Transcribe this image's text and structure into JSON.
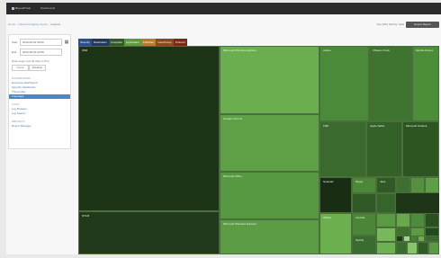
{
  "app": {
    "name": "BeyondTrust",
    "nav_link": "Dashboards",
    "header_right": ""
  },
  "breadcrumb": {
    "items": [
      "Home",
      "Threat & Integrity Layout",
      "Analysis"
    ]
  },
  "header": {
    "meta": "Top 100 | Sort by: Size",
    "button_label": "Export Report"
  },
  "sidebar": {
    "start_label": "Start",
    "start_value": "2013-06-01 00:00",
    "end_label": "End",
    "end_value": "2013-06-30 23:59",
    "range_note": "Date range: last 30 days (UTC)",
    "segments": [
      "Count",
      "Duration"
    ],
    "sections": [
      {
        "heading": "Dashboards",
        "items": [
          "Executive Dashboard",
          "Security Dashboard",
          "Threat Map",
          "Treemaps"
        ]
      },
      {
        "heading": "Logs",
        "items": [
          "Log Browser",
          "Log Search"
        ]
      },
      {
        "heading": "Reports",
        "items": [
          "Report Manager"
        ]
      }
    ]
  },
  "tabs": [
    {
      "label": "Severity",
      "color": "#2c4f8a"
    },
    {
      "label": "Destination",
      "color": "#23375f"
    },
    {
      "label": "Computer",
      "color": "#355c24"
    },
    {
      "label": "Application",
      "color": "#5f9a40"
    },
    {
      "label": "Publisher",
      "color": "#b87b2e"
    },
    {
      "label": "User/Group",
      "color": "#8a4a1d"
    },
    {
      "label": "Protocol",
      "color": "#7a2c12"
    }
  ],
  "treemap": {
    "colors": {
      "border": "#4a6e3c",
      "background": "#1e3518"
    },
    "tiles": [
      {
        "label": "WMI",
        "color": "#1d3417"
      },
      {
        "label": "NTLM",
        "color": "#223a1b"
      },
      {
        "label": "Microsoft Windows Explorer",
        "color": "#6aae4f"
      },
      {
        "label": "Google Chrome",
        "color": "#5fa047"
      },
      {
        "label": "Microsoft Office",
        "color": "#579842"
      },
      {
        "label": "Microsoft Windows Explorer",
        "color": "#5b9c44"
      },
      {
        "label": "Adobe",
        "color": "#4b8a38"
      },
      {
        "label": "VMware Tools",
        "color": "#3e7330"
      },
      {
        "label": "Mozilla Firefox",
        "color": "#4b8d39"
      },
      {
        "label": "LWP",
        "color": "#3a6a2d"
      },
      {
        "label": "Apple Safari",
        "color": "#346128"
      },
      {
        "label": "Microsoft Outlook",
        "color": "#2c5522"
      },
      {
        "label": "Notepad",
        "color": "#182d13"
      },
      {
        "label": "Skype",
        "color": "#4c8838"
      },
      {
        "label": "Java",
        "color": "#2f5a25"
      },
      {
        "label": "",
        "color": "#3d6f30"
      },
      {
        "label": "",
        "color": "#558f40"
      },
      {
        "label": "",
        "color": "#5e9f46"
      },
      {
        "label": "",
        "color": "#2e5924"
      },
      {
        "label": "",
        "color": "#36642a"
      },
      {
        "label": "Winzip",
        "color": "#6caf4f"
      },
      {
        "label": "Acrobat",
        "color": "#4a8538"
      },
      {
        "label": "Spotify",
        "color": "#3b6c2f"
      },
      {
        "label": "",
        "color": "#5a9a43"
      },
      {
        "label": "",
        "color": "#66a84b"
      },
      {
        "label": "",
        "color": "#4e8c3b"
      },
      {
        "label": "",
        "color": "#2a5020"
      },
      {
        "label": "",
        "color": "#77b95a"
      },
      {
        "label": "",
        "color": "#3f7232"
      },
      {
        "label": "",
        "color": "#5b9b44"
      },
      {
        "label": "",
        "color": "#244a1c"
      },
      {
        "label": "",
        "color": "#6eb152"
      },
      {
        "label": "",
        "color": "#3b6c2f"
      },
      {
        "label": "",
        "color": "#89c46b"
      },
      {
        "label": "",
        "color": "#2f5a25"
      },
      {
        "label": "",
        "color": "#5a9a43"
      },
      {
        "label": "",
        "color": "#1f3a18"
      },
      {
        "label": "",
        "color": "#a3d386"
      },
      {
        "label": "",
        "color": "#477f36"
      },
      {
        "label": "",
        "color": "#6aae4f"
      },
      {
        "label": "",
        "color": "#39692d"
      }
    ]
  }
}
